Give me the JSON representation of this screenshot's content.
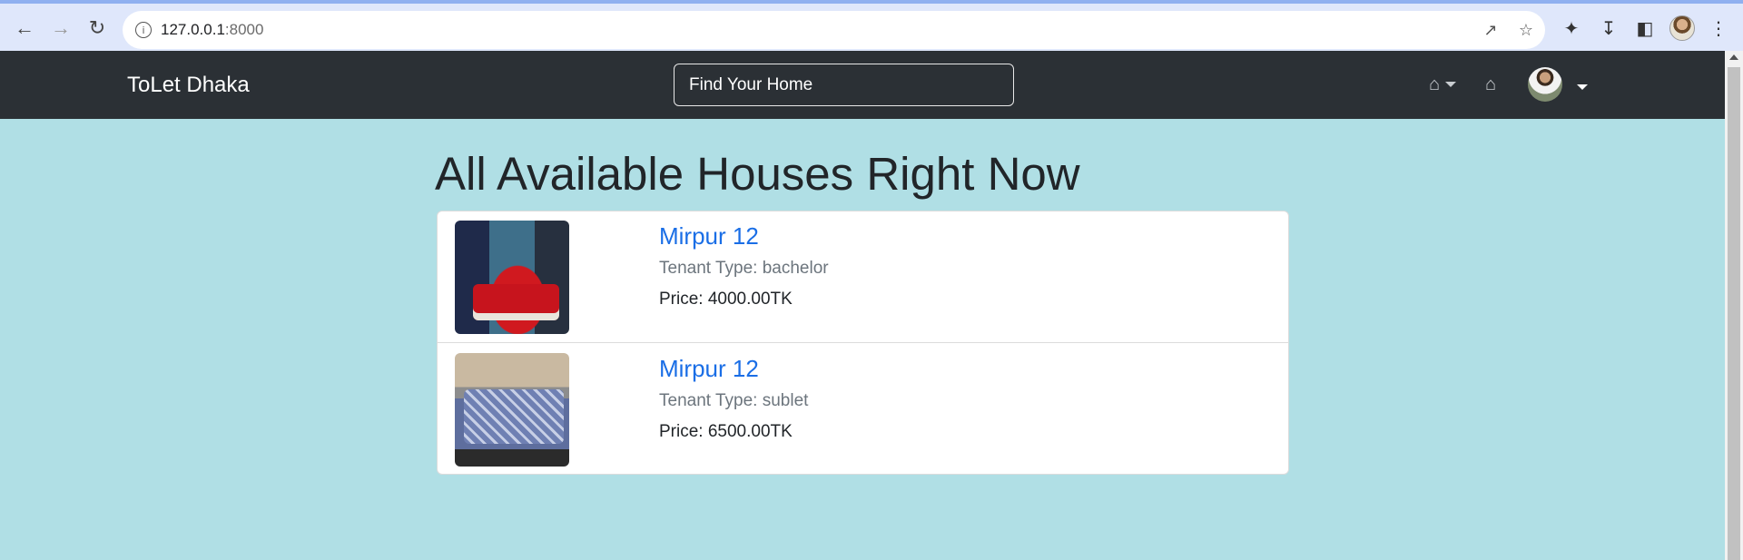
{
  "browser": {
    "url_host": "127.0.0.1",
    "url_port": ":8000"
  },
  "navbar": {
    "brand": "ToLet Dhaka",
    "search_placeholder": "Find Your Home"
  },
  "main": {
    "heading": "All Available Houses Right Now",
    "listings": [
      {
        "location": "Mirpur 12",
        "tenant_type": "Tenant Type: bachelor",
        "price": "Price: 4000.00TK"
      },
      {
        "location": "Mirpur 12",
        "tenant_type": "Tenant Type: sublet",
        "price": "Price: 6500.00TK"
      }
    ]
  },
  "colors": {
    "page_background": "#b0dfe5",
    "navbar_background": "#2b3035",
    "link": "#1a6ee6"
  }
}
